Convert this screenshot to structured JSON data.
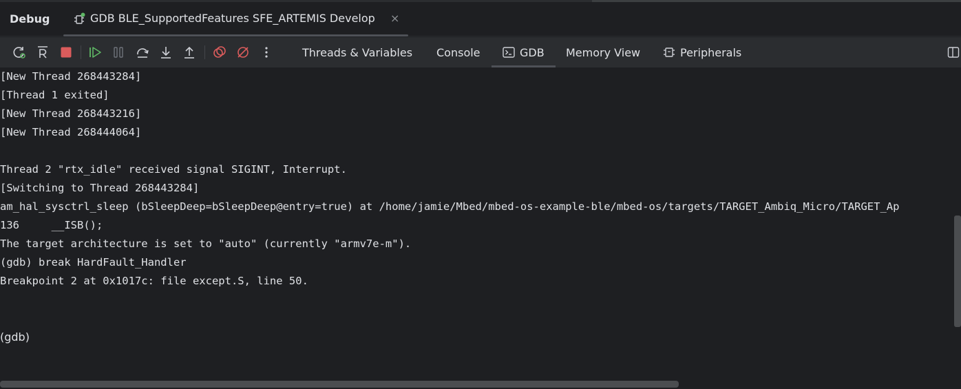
{
  "window": {
    "title": "Debug",
    "session_tab": "GDB BLE_SupportedFeatures SFE_ARTEMIS Develop",
    "close_glyph": "×"
  },
  "toolbar": {
    "icons": [
      "rerun-icon",
      "restart-icon",
      "stop-icon",
      "resume-icon",
      "pause-icon",
      "step-over-icon",
      "step-into-icon",
      "step-out-icon",
      "view-breakpoints-icon",
      "mute-breakpoints-icon",
      "more-icon"
    ],
    "tabs": [
      {
        "label": "Threads & Variables",
        "active": false
      },
      {
        "label": "Console",
        "active": false
      },
      {
        "label": "GDB",
        "active": true
      },
      {
        "label": "Memory View",
        "active": false
      },
      {
        "label": "Peripherals",
        "active": false
      }
    ],
    "colors": {
      "accent_green": "#5fb865",
      "stop_red": "#db5c5c"
    }
  },
  "console": {
    "lines": [
      "[New Thread 268443284]",
      "[Thread 1 exited]",
      "[New Thread 268443216]",
      "[New Thread 268444064]",
      "",
      "Thread 2 \"rtx_idle\" received signal SIGINT, Interrupt.",
      "[Switching to Thread 268443284]",
      "am_hal_sysctrl_sleep (bSleepDeep=bSleepDeep@entry=true) at /home/jamie/Mbed/mbed-os-example-ble/mbed-os/targets/TARGET_Ambiq_Micro/TARGET_Ap",
      "136     __ISB();",
      "The target architecture is set to \"auto\" (currently \"armv7e-m\").",
      "(gdb) break HardFault_Handler",
      "Breakpoint 2 at 0x1017c: file except.S, line 50."
    ],
    "prompt": "(gdb)"
  }
}
